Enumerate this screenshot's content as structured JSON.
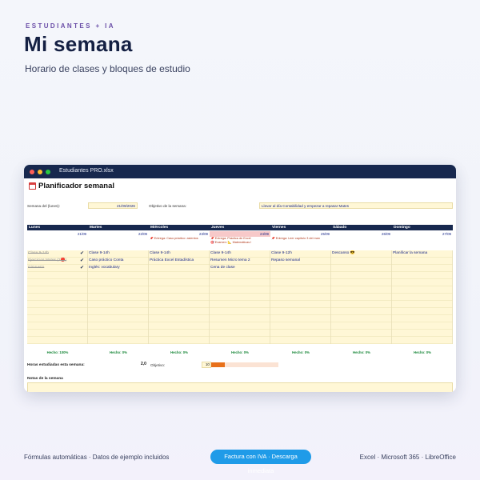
{
  "brand": "ESTUDIANTES + IA",
  "hero": {
    "title": "Mi semana",
    "subtitle": "Horario de clases y bloques de estudio"
  },
  "window": {
    "title": "Estudiantes PRO.xlsx"
  },
  "sheet": {
    "title": "Planificador semanal",
    "week_label": "Semana del (lunes):",
    "week_value": "21/09/2026",
    "objective_label": "Objetivo de la semana:",
    "objective_value": "Llevar al día Contabilidad y empezar a repasar Mates",
    "days": [
      "Lunes",
      "Martes",
      "Miércoles",
      "Jueves",
      "Viernes",
      "Sábado",
      "Domingo"
    ],
    "dates": [
      "21/09",
      "22/09",
      "23/09",
      "24/09",
      "25/09",
      "26/09",
      "27/09"
    ],
    "highlight_day_index": 3,
    "notes": [
      [],
      [],
      [
        "📌 Entrega: Caso práctico: asientos"
      ],
      [
        "📌 Entrega: Práctica de Excel",
        "🎯 Examen: 📐 Matemáticas I"
      ],
      [
        "📌 Entrega: Leer capítulo 3 del man"
      ],
      [],
      []
    ],
    "rows": [
      [
        {
          "text": "Clase 9-14h",
          "done": true
        },
        {
          "text": "Clase 9-14h",
          "done": false,
          "check": true
        },
        {
          "text": "Clase 9-14h",
          "done": false
        },
        {
          "text": "Clase 9-14h",
          "done": false
        },
        {
          "text": "Clase 9-12h",
          "done": false
        },
        {
          "text": "Descanso 😎",
          "done": false
        },
        {
          "text": "Planificar la semana",
          "done": false
        }
      ],
      [
        {
          "text": "Ejercicios Mates (2🔴)",
          "done": true
        },
        {
          "text": "Caso práctico Conta",
          "done": false,
          "check": true
        },
        {
          "text": "Práctica Excel Estadística",
          "done": false
        },
        {
          "text": "Resumen Micro tema 2",
          "done": false
        },
        {
          "text": "Repaso semanal",
          "done": false
        },
        {
          "text": "",
          "done": false
        },
        {
          "text": "",
          "done": false
        }
      ],
      [
        {
          "text": "Gimnasio",
          "done": true
        },
        {
          "text": "Inglés: vocabulary",
          "done": false,
          "check": true
        },
        {
          "text": "",
          "done": false
        },
        {
          "text": "Cena de clase",
          "done": false
        },
        {
          "text": "",
          "done": false
        },
        {
          "text": "",
          "done": false
        },
        {
          "text": "",
          "done": false
        }
      ]
    ],
    "hecho": [
      "Hecho: 100%",
      "Hecho: 0%",
      "Hecho: 0%",
      "Hecho: 0%",
      "Hecho: 0%",
      "Hecho: 0%",
      "Hecho: 0%"
    ],
    "hours_label": "Horas estudiadas esta semana:",
    "hours_value": "2,0",
    "goal_label": "Objetivo:",
    "goal_value": "10",
    "hours_progress": 0.2,
    "notes_label": "Notas de la semana"
  },
  "footer": {
    "left": "Fórmulas automáticas · Datos de ejemplo incluidos",
    "button": "Factura con IVA · Descarga inmediata",
    "right": "Excel · Microsoft 365 · LibreOffice"
  },
  "colors": {
    "navy": "#17284e",
    "accent_blue": "#1f9be8",
    "progress_orange": "#e8701a",
    "cell_yellow": "#fff7d6"
  }
}
